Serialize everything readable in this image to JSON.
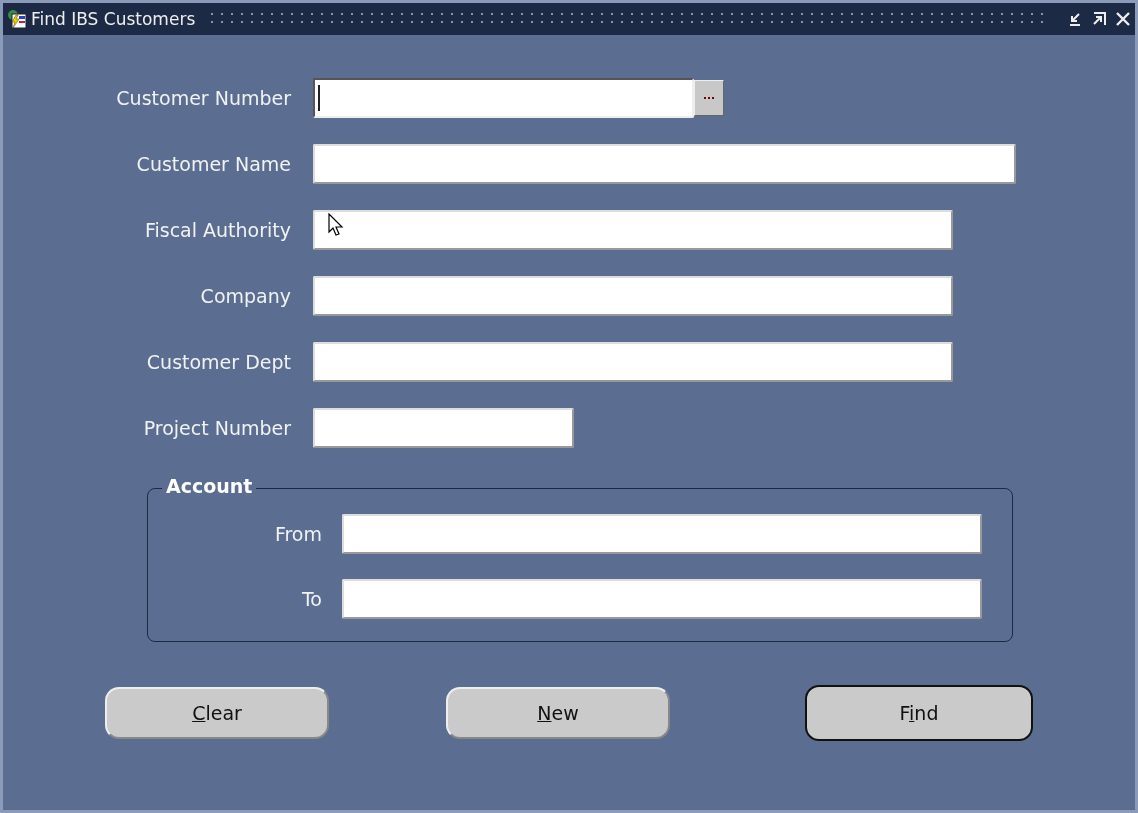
{
  "window": {
    "title": "Find IBS Customers"
  },
  "fields": [
    {
      "label": "Customer Number",
      "focused": true,
      "lov": true
    },
    {
      "label": "Customer Name",
      "focused": false,
      "lov": false
    },
    {
      "label": "Fiscal Authority",
      "focused": false,
      "lov": false
    },
    {
      "label": "Company",
      "focused": false,
      "lov": false
    },
    {
      "label": "Customer Dept",
      "focused": false,
      "lov": false
    },
    {
      "label": "Project Number",
      "focused": false,
      "lov": false
    }
  ],
  "account": {
    "title": "Account",
    "fields": [
      {
        "label": "From"
      },
      {
        "label": "To"
      }
    ]
  },
  "buttons": [
    {
      "key": "C",
      "after": "lear",
      "default": false
    },
    {
      "key": "N",
      "after": "ew",
      "default": false
    },
    {
      "before": "F",
      "key": "i",
      "after": "nd",
      "default": true
    }
  ]
}
